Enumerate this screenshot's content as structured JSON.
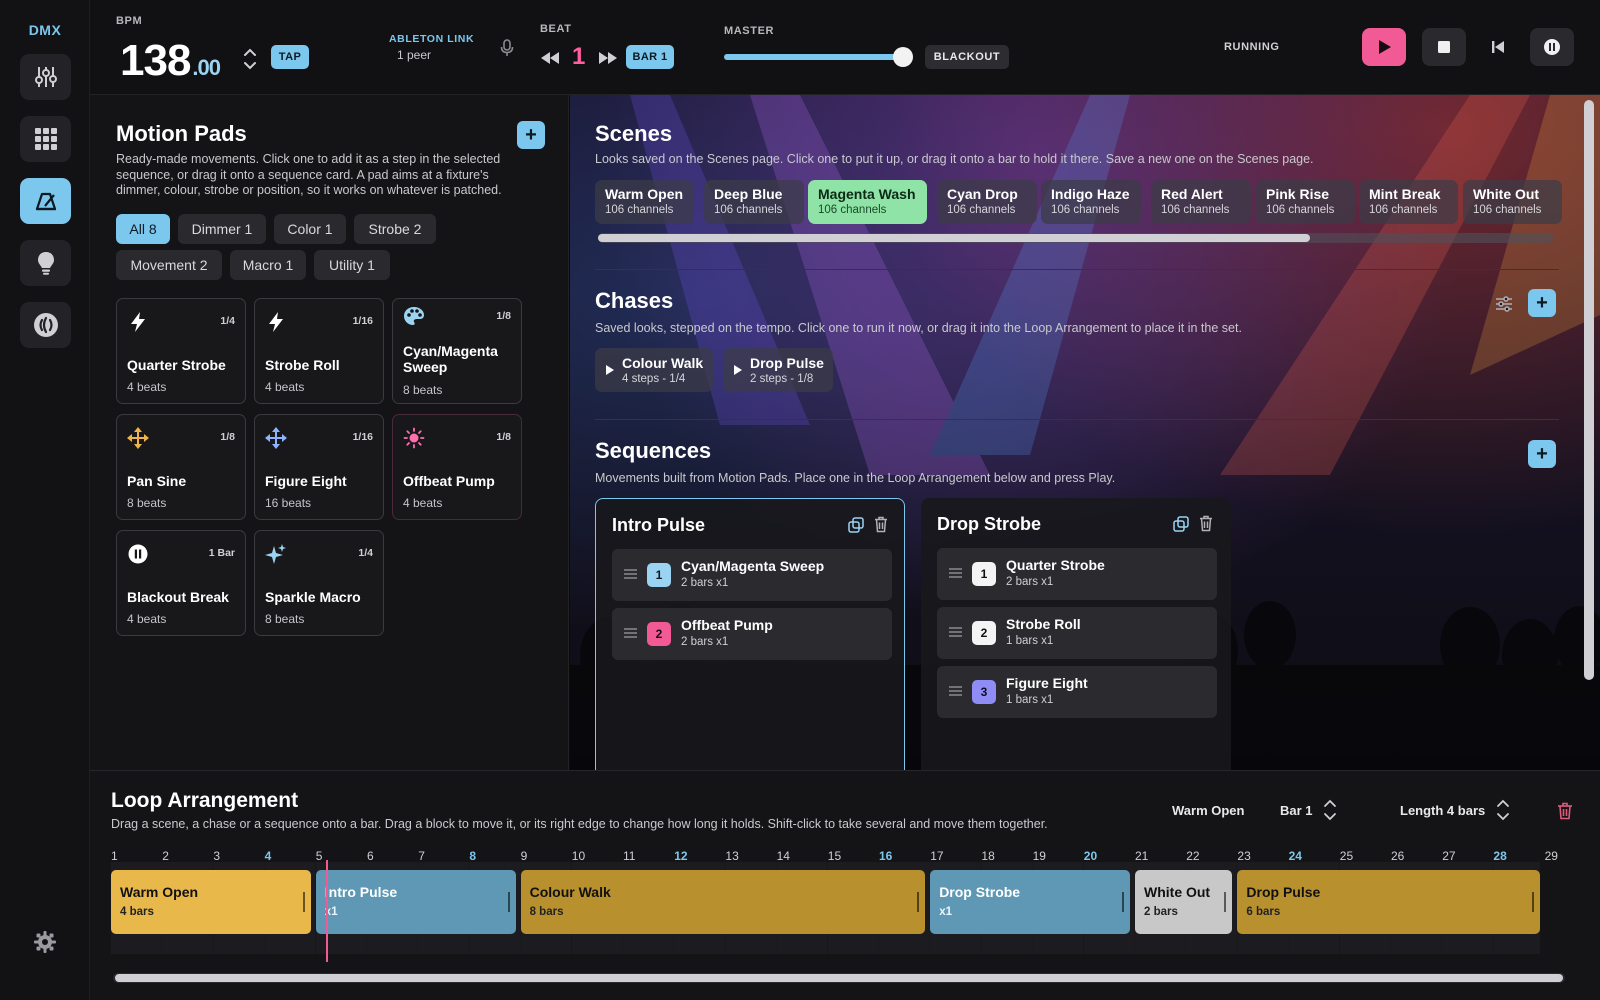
{
  "brand": "DMX",
  "transport": {
    "bpm_label": "BPM",
    "bpm_int": "138",
    "bpm_dec": ".00",
    "tap": "TAP",
    "link_label": "ABLETON LINK",
    "link_peers": "1 peer",
    "beat_label": "BEAT",
    "beat_value": "1",
    "bar_chip": "BAR 1",
    "master_label": "MASTER",
    "master_level": 0.95,
    "blackout": "BLACKOUT",
    "status": "RUNNING"
  },
  "motion_pads": {
    "title": "Motion Pads",
    "desc_1": "Ready-made movements. Click one to add it as a step in the selected",
    "desc_2": "sequence, or drag it onto a sequence card. A pad aims at a fixture's",
    "desc_3": "dimmer, colour, strobe or position, so it works on whatever is patched.",
    "filters": [
      "All 8",
      "Dimmer 1",
      "Color 1",
      "Strobe 2",
      "Movement 2",
      "Macro 1",
      "Utility 1"
    ],
    "pads": [
      {
        "name": "Quarter Strobe",
        "rate": "1/4",
        "beats": "4 beats",
        "icon": "bolt-icon"
      },
      {
        "name": "Strobe Roll",
        "rate": "1/16",
        "beats": "4 beats",
        "icon": "bolt-icon"
      },
      {
        "name": "Cyan/Magenta Sweep",
        "rate": "1/8",
        "beats": "8 beats",
        "icon": "palette-icon"
      },
      {
        "name": "Pan Sine",
        "rate": "1/8",
        "beats": "8 beats",
        "icon": "move-arrows-icon"
      },
      {
        "name": "Figure Eight",
        "rate": "1/16",
        "beats": "16 beats",
        "icon": "move-arrows-icon"
      },
      {
        "name": "Offbeat Pump",
        "rate": "1/8",
        "beats": "4 beats",
        "icon": "sun-icon"
      },
      {
        "name": "Blackout Break",
        "rate": "1 Bar",
        "beats": "4 beats",
        "icon": "pause-icon"
      },
      {
        "name": "Sparkle Macro",
        "rate": "1/4",
        "beats": "8 beats",
        "icon": "sparkle-icon"
      }
    ]
  },
  "scenes": {
    "title": "Scenes",
    "desc": "Looks saved on the Scenes page. Click one to put it up, or drag it onto a bar to hold it there. Save a new one on the Scenes page.",
    "items": [
      {
        "name": "Warm Open",
        "sub": "106 channels"
      },
      {
        "name": "Deep Blue",
        "sub": "106 channels"
      },
      {
        "name": "Magenta Wash",
        "sub": "106 channels"
      },
      {
        "name": "Cyan Drop",
        "sub": "106 channels"
      },
      {
        "name": "Indigo Haze",
        "sub": "106 channels"
      },
      {
        "name": "Red Alert",
        "sub": "106 channels"
      },
      {
        "name": "Pink Rise",
        "sub": "106 channels"
      },
      {
        "name": "Mint Break",
        "sub": "106 channels"
      },
      {
        "name": "White Out",
        "sub": "106 channels"
      }
    ]
  },
  "chases": {
    "title": "Chases",
    "desc": "Saved looks, stepped on the tempo. Click one to run it now, or drag it into the Loop Arrangement to place it in the set.",
    "items": [
      {
        "name": "Colour Walk",
        "sub": "4 steps - 1/4"
      },
      {
        "name": "Drop Pulse",
        "sub": "2 steps - 1/8"
      }
    ]
  },
  "sequences": {
    "title": "Sequences",
    "desc": "Movements built from Motion Pads. Place one in the Loop Arrangement below and press Play.",
    "cards": [
      {
        "name": "Intro Pulse",
        "steps": [
          {
            "n": "1",
            "name": "Cyan/Magenta Sweep",
            "sub": "2 bars x1"
          },
          {
            "n": "2",
            "name": "Offbeat Pump",
            "sub": "2 bars x1"
          }
        ]
      },
      {
        "name": "Drop Strobe",
        "steps": [
          {
            "n": "1",
            "name": "Quarter Strobe",
            "sub": "2 bars x1"
          },
          {
            "n": "2",
            "name": "Strobe Roll",
            "sub": "1 bars x1"
          },
          {
            "n": "3",
            "name": "Figure Eight",
            "sub": "1 bars x1"
          }
        ]
      }
    ]
  },
  "loop": {
    "title": "Loop Arrangement",
    "desc": "Drag a scene, a chase or a sequence onto a bar. Drag a block to move it, or its right edge to change how long it holds. Shift-click to take several and move them together.",
    "selected": "Warm Open",
    "bar": "Bar 1",
    "length": "Length 4 bars",
    "ticks": [
      "1",
      "2",
      "3",
      "4",
      "5",
      "6",
      "7",
      "8",
      "9",
      "10",
      "11",
      "12",
      "13",
      "14",
      "15",
      "16",
      "17",
      "18",
      "19",
      "20",
      "21",
      "22",
      "23",
      "24",
      "25",
      "26",
      "27",
      "28",
      "29"
    ],
    "playhead_bar": 5.2,
    "blocks": [
      {
        "name": "Warm Open",
        "sub": "4 bars",
        "start": 1,
        "len": 4,
        "kind": "scene",
        "color": "#e8b84a"
      },
      {
        "name": "Intro Pulse",
        "sub": "x1",
        "start": 5,
        "len": 4,
        "kind": "sequence",
        "color": "#5e98b4"
      },
      {
        "name": "Colour Walk",
        "sub": "8 bars",
        "start": 9,
        "len": 8,
        "kind": "chase",
        "color": "#b8902e"
      },
      {
        "name": "Drop Strobe",
        "sub": "x1",
        "start": 17,
        "len": 4,
        "kind": "sequence",
        "color": "#5e98b4"
      },
      {
        "name": "White Out",
        "sub": "2 bars",
        "start": 21,
        "len": 2,
        "kind": "scene",
        "color": "#c8c8c8"
      },
      {
        "name": "Drop Pulse",
        "sub": "6 bars",
        "start": 23,
        "len": 6,
        "kind": "chase",
        "color": "#b8902e"
      }
    ]
  }
}
